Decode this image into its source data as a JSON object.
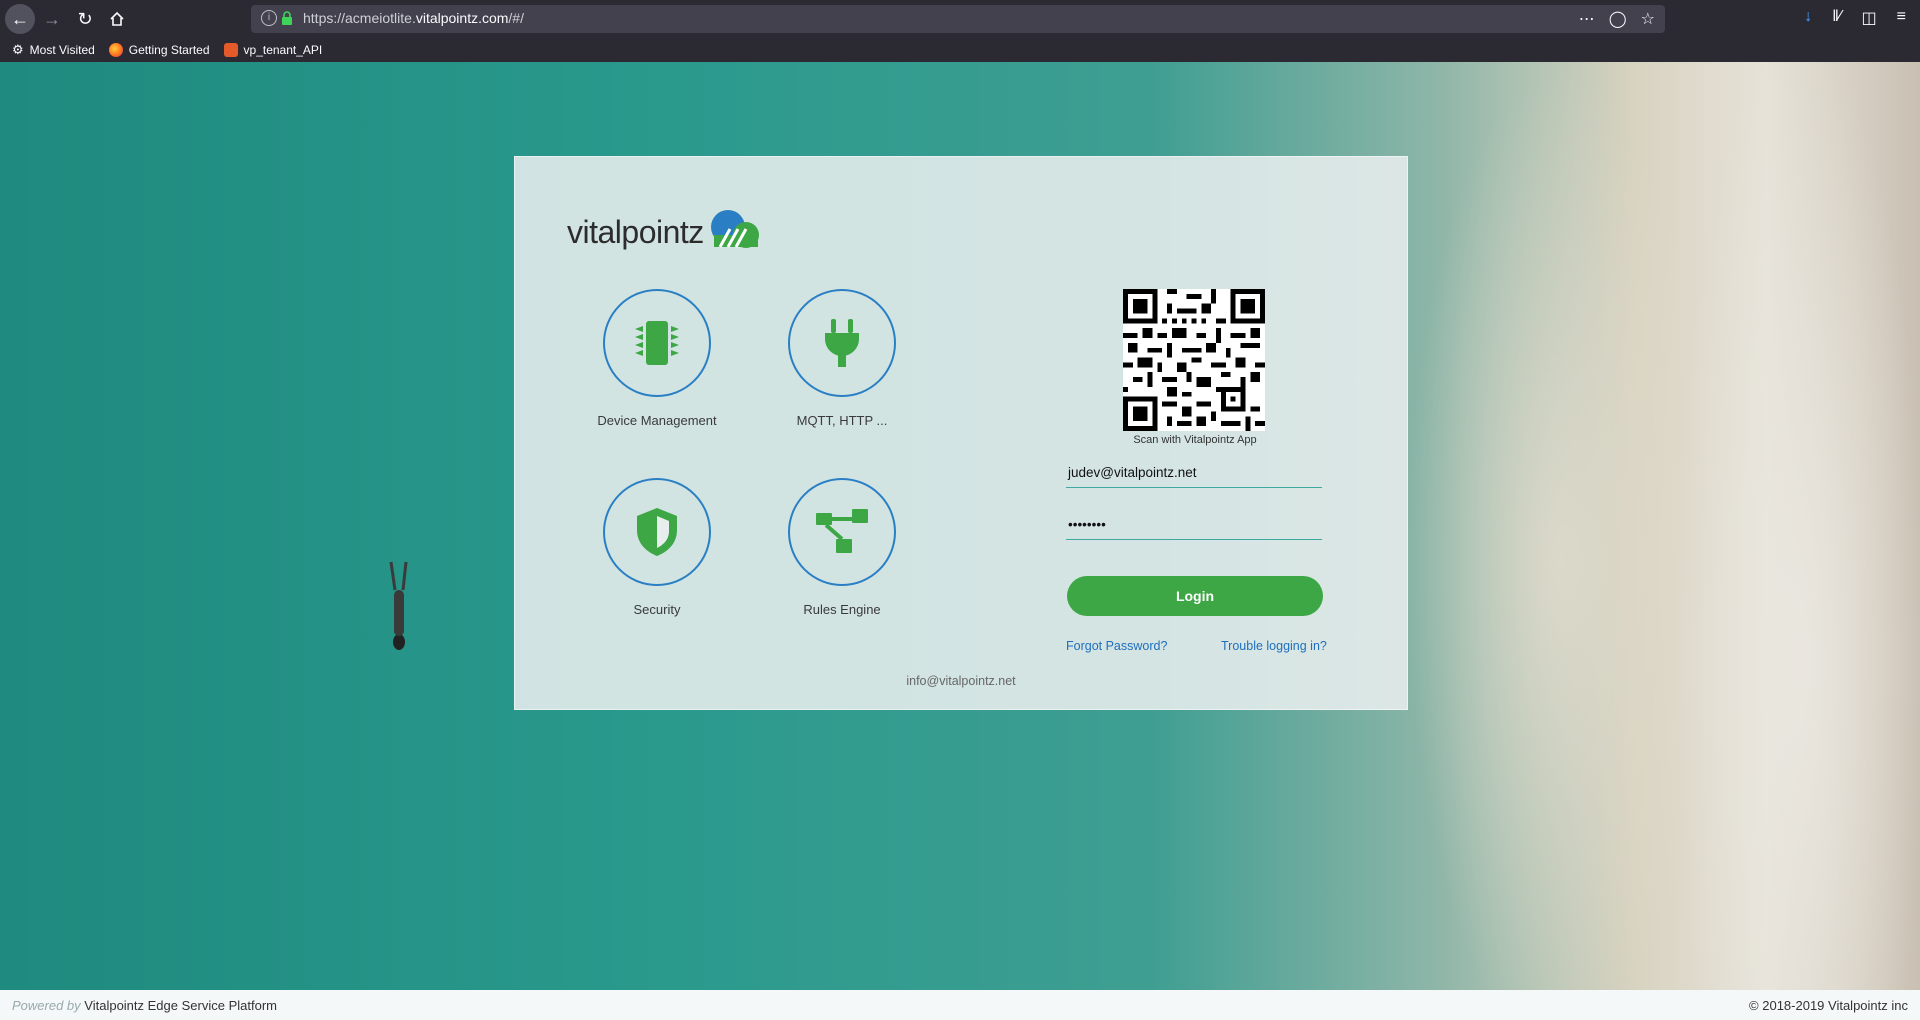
{
  "browser": {
    "url_prefix": "https://acmeiotlite.",
    "url_domain": "vitalpointz.com",
    "url_suffix": "/#/",
    "bookmarks": [
      {
        "label": "Most Visited",
        "icon": "gear-icon"
      },
      {
        "label": "Getting Started",
        "icon": "firefox-icon"
      },
      {
        "label": "vp_tenant_API",
        "icon": "api-icon"
      }
    ]
  },
  "login": {
    "brand": "vitalpointz",
    "features": [
      {
        "label": "Device Management",
        "icon": "chip-icon"
      },
      {
        "label": "MQTT, HTTP ...",
        "icon": "plug-icon"
      },
      {
        "label": "Security",
        "icon": "shield-icon"
      },
      {
        "label": "Rules Engine",
        "icon": "flow-icon"
      }
    ],
    "qr_caption": "Scan with Vitalpointz App",
    "username": "judev@vitalpointz.net",
    "password_mask": "••••••••",
    "login_label": "Login",
    "forgot_label": "Forgot Password?",
    "trouble_label": "Trouble logging in?",
    "contact_email": "info@vitalpointz.net"
  },
  "footer": {
    "powered_by": "Powered by",
    "platform": "Vitalpointz Edge Service Platform",
    "copyright": "© 2018-2019 Vitalpointz inc"
  },
  "colors": {
    "accent_green": "#3ca744",
    "ring_blue": "#2a7fc4",
    "link_blue": "#1f6fbf"
  }
}
